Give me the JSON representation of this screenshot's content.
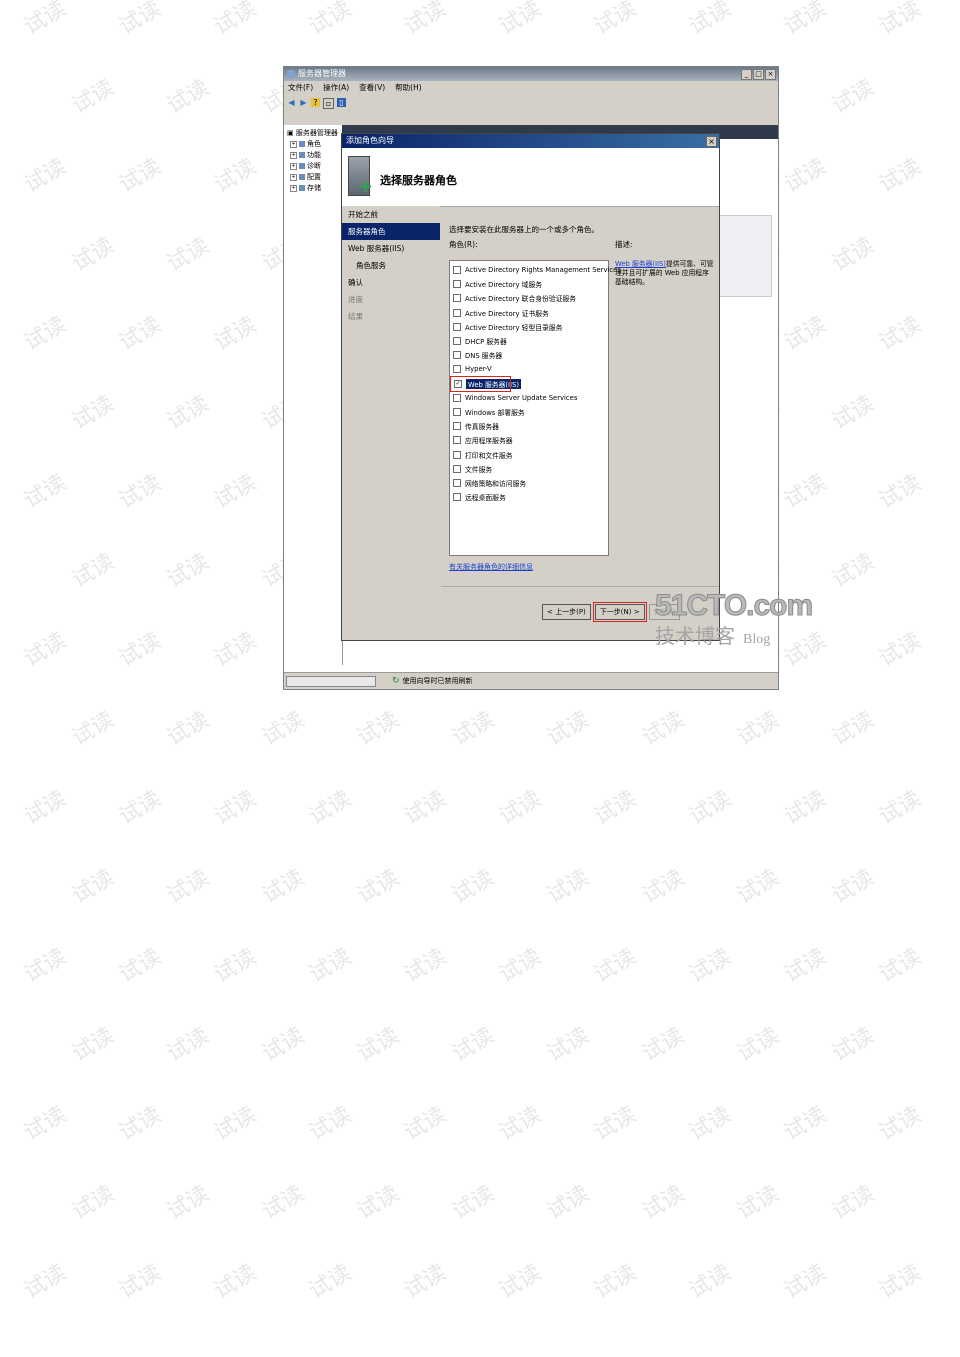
{
  "watermark_text": "试读",
  "server_manager": {
    "title": "服务器管理器",
    "menu": [
      "文件(F)",
      "操作(A)",
      "查看(V)",
      "帮助(H)"
    ],
    "tree_header": "服务器管理器",
    "tree_nodes": [
      "角色",
      "功能",
      "诊断",
      "配置",
      "存储"
    ],
    "status_text": "使用向导时已禁用刷新"
  },
  "wizard": {
    "title": "添加角色向导",
    "heading": "选择服务器角色",
    "nav": [
      {
        "label": "开始之前",
        "state": "normal"
      },
      {
        "label": "服务器角色",
        "state": "active"
      },
      {
        "label": "Web 服务器(IIS)",
        "state": "normal"
      },
      {
        "label": "角色服务",
        "state": "sub"
      },
      {
        "label": "确认",
        "state": "normal"
      },
      {
        "label": "进度",
        "state": "dim"
      },
      {
        "label": "结果",
        "state": "dim"
      }
    ],
    "intro": "选择要安装在此服务器上的一个或多个角色。",
    "roles_label": "角色(R):",
    "description_label": "描述:",
    "roles": [
      {
        "label": "Active Directory Rights Management Services",
        "checked": false
      },
      {
        "label": "Active Directory 域服务",
        "checked": false
      },
      {
        "label": "Active Directory 联合身份验证服务",
        "checked": false
      },
      {
        "label": "Active Directory 证书服务",
        "checked": false
      },
      {
        "label": "Active Directory 轻型目录服务",
        "checked": false
      },
      {
        "label": "DHCP 服务器",
        "checked": false
      },
      {
        "label": "DNS 服务器",
        "checked": false
      },
      {
        "label": "Hyper-V",
        "checked": false
      },
      {
        "label": "Web 服务器(IIS)",
        "checked": true
      },
      {
        "label": "Windows Server Update Services",
        "checked": false
      },
      {
        "label": "Windows 部署服务",
        "checked": false
      },
      {
        "label": "传真服务器",
        "checked": false
      },
      {
        "label": "应用程序服务器",
        "checked": false
      },
      {
        "label": "打印和文件服务",
        "checked": false
      },
      {
        "label": "文件服务",
        "checked": false
      },
      {
        "label": "网络策略和访问服务",
        "checked": false
      },
      {
        "label": "远程桌面服务",
        "checked": false
      }
    ],
    "description_link": "Web 服务器(IIS)",
    "description_text": "提供可靠、可管理并且可扩展的 Web 应用程序基础结构。",
    "more_link": "有关服务器角色的详细信息",
    "buttons": {
      "prev": "< 上一步(P)",
      "next": "下一步(N) >",
      "install": "安装(I)"
    }
  },
  "blog_mark": {
    "line1": "51CTO.com",
    "line2": "技术博客",
    "line2b": "Blog"
  },
  "colors": {
    "highlight_red": "#d9261c",
    "selection_blue": "#0a246a",
    "link_blue": "#1a3fd1"
  }
}
